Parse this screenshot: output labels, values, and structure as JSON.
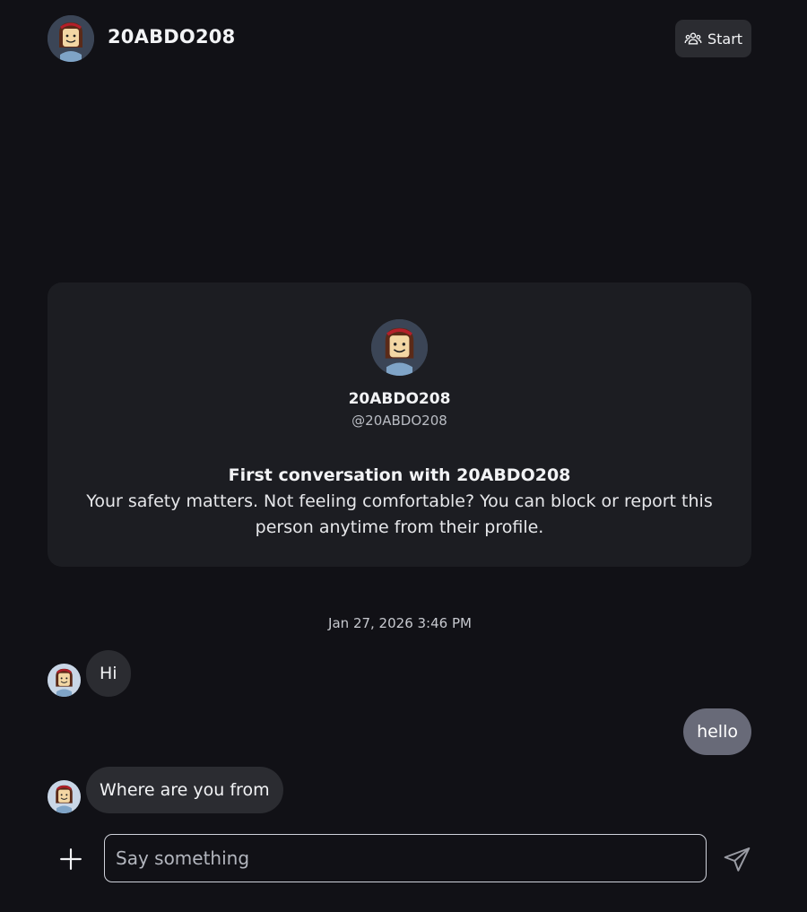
{
  "header": {
    "name": "20ABDO208",
    "avatar_icon": "user-avatar",
    "start_icon": "people-group-icon",
    "start_label": "Start"
  },
  "intro": {
    "name": "20ABDO208",
    "handle": "@20ABDO208",
    "title": "First conversation with 20ABDO208",
    "message": "Your safety matters. Not feeling comfortable? You can block or report this person anytime from their profile."
  },
  "timestamp": "Jan 27, 2026 3:46 PM",
  "messages": [
    {
      "direction": "in",
      "text": "Hi"
    },
    {
      "direction": "out",
      "text": "hello"
    },
    {
      "direction": "in",
      "text": "Where are you from"
    }
  ],
  "composer": {
    "add_icon": "plus-icon",
    "placeholder": "Say something",
    "value": "",
    "send_icon": "send-icon"
  },
  "colors": {
    "background": "#111116",
    "card": "#1c1d22",
    "incoming_bubble": "#2b2c31",
    "outgoing_bubble": "#686a78"
  }
}
